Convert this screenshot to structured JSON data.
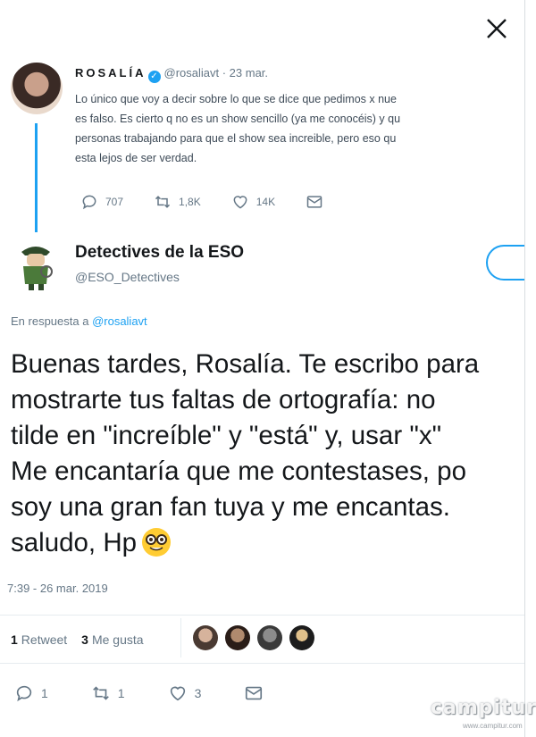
{
  "parent_tweet": {
    "name": "ROSALÍA",
    "handle": "@rosaliavt",
    "date": "· 23 mar.",
    "lines": [
      "Lo único que voy a decir sobre lo que se dice que pedimos x nue",
      "es falso. Es cierto q no es un show sencillo (ya me conocéis) y qu",
      "personas trabajando para que el show sea increible, pero eso qu",
      "esta lejos de ser verdad."
    ],
    "replies": "707",
    "retweets": "1,8K",
    "likes": "14K"
  },
  "main_tweet": {
    "name": "Detectives de la ESO",
    "handle": "@ESO_Detectives",
    "reply_prefix": "En respuesta a ",
    "reply_handle": "@rosaliavt",
    "lines": [
      "Buenas tardes, Rosalía. Te escribo para",
      "mostrarte tus faltas de ortografía: no",
      "tilde en \"increíble\" y \"está\" y, usar \"x\"",
      "Me encantaría que me contestases, po",
      "soy una gran fan tuya y me encantas. ",
      "saludo, Hp"
    ],
    "timestamp": "7:39 - 26 mar. 2019",
    "retweet_count": "1",
    "retweet_label": "Retweet",
    "like_count": "3",
    "like_label": "Me gusta",
    "action_replies": "1",
    "action_retweets": "1",
    "action_likes": "3"
  },
  "watermark": {
    "logo": "campitur",
    "url": "www.campitur.com"
  },
  "icons": [
    "close-icon",
    "verified-icon",
    "reply-icon",
    "retweet-icon",
    "like-icon",
    "message-icon",
    "nerd-face-emoji"
  ],
  "colors": {
    "accent": "#1da1f2",
    "text": "#14171a",
    "muted": "#657786"
  }
}
